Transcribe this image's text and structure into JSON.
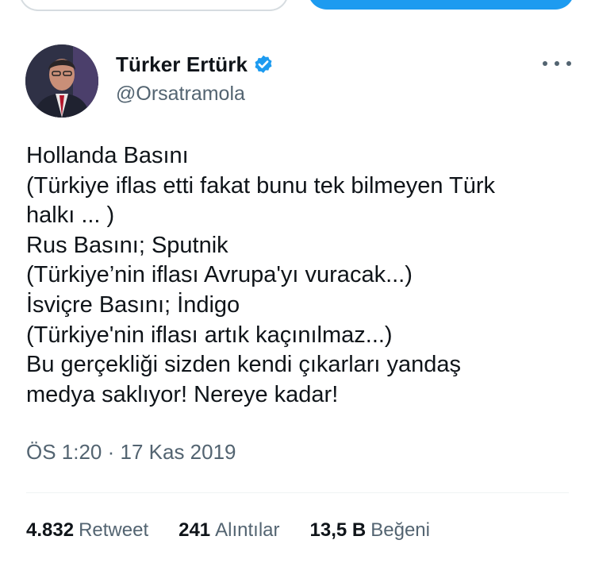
{
  "author": {
    "display_name": "Türker Ertürk",
    "handle": "@Orsatramola",
    "verified_icon": "verified-badge-icon",
    "avatar_icon": "avatar-photo"
  },
  "tweet": {
    "lines": [
      "Hollanda Basını",
      "(Türkiye iflas etti fakat bunu tek bilmeyen Türk",
      "halkı ... )",
      "Rus Basını; Sputnik",
      "(Türkiye’nin iflası Avrupa'yı vuracak...)",
      "İsviçre Basını; İndigo",
      "(Türkiye'nin iflası artık kaçınılmaz...)",
      "Bu gerçekliği sizden kendi çıkarları yandaş",
      "medya saklıyor! Nereye kadar!"
    ],
    "timestamp": "ÖS 1:20 · 17 Kas 2019"
  },
  "stats": {
    "retweets": {
      "count": "4.832",
      "label": "Retweet"
    },
    "quotes": {
      "count": "241",
      "label": "Alıntılar"
    },
    "likes": {
      "count": "13,5 B",
      "label": "Beğeni"
    }
  },
  "colors": {
    "accent": "#1d9bf0",
    "text": "#0f1419",
    "secondary": "#536471"
  }
}
